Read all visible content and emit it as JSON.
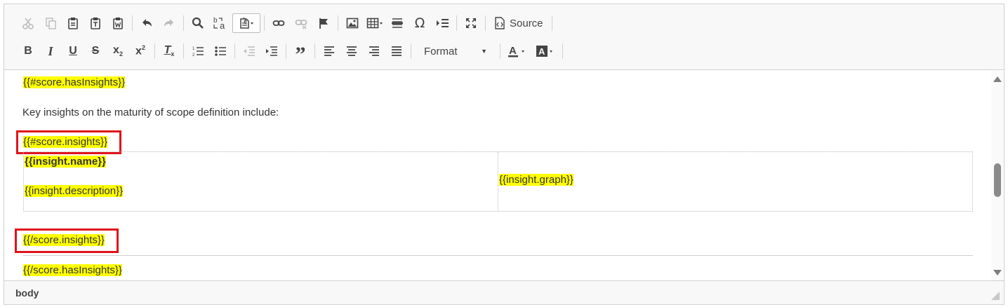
{
  "toolbar": {
    "source_label": "Source",
    "format_label": "Format"
  },
  "content": {
    "line_has_insights_open": "{{#score.hasInsights}}",
    "paragraph": "Key insights on the maturity of scope definition include:",
    "line_insights_open": "{{#score.insights}}",
    "insight_name": "{{insight.name}}",
    "insight_description": "{{insight.description}}",
    "insight_graph": "{{insight.graph}}",
    "line_insights_close": "{{/score.insights}}",
    "line_has_insights_close": "{{/score.hasInsights}}"
  },
  "statusbar": {
    "path": "body"
  },
  "colors": {
    "highlight": "#ffff00",
    "annotation_red": "#e0131b"
  }
}
